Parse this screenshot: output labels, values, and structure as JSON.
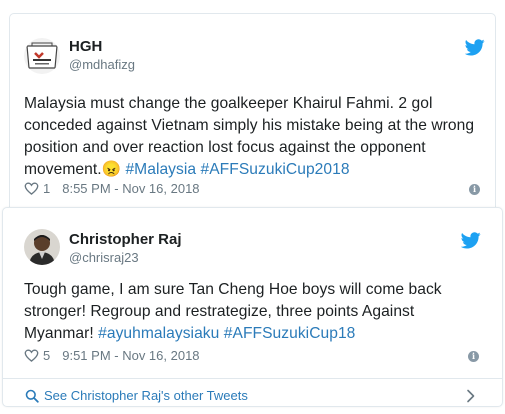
{
  "tweets": [
    {
      "name": "HGH",
      "handle": "@mdhafizg",
      "text_main": "Malaysia must change the goalkeeper Khairul Fahmi. 2 gol conceded against Vietnam simply his mistake being at the wrong position and over reaction lost focus against the opponent movement.",
      "emoji": "😠",
      "hashtags": [
        "#Malaysia",
        "#AFFSuzukiCup2018"
      ],
      "likes": "1",
      "time": "8:55 PM - Nov 16, 2018"
    },
    {
      "name": "Christopher Raj",
      "handle": "@chrisraj23",
      "text_main": "Tough game, I am sure Tan Cheng Hoe boys will come back stronger! Regroup and restrategize, three points Against Myanmar!",
      "hashtags": [
        "#ayuhmalaysiaku",
        "#AFFSuzukiCup18"
      ],
      "likes": "5",
      "time": "9:51 PM - Nov 16, 2018"
    }
  ],
  "footer": {
    "other_tweets_label": "See Christopher Raj's other Tweets"
  },
  "colors": {
    "link_blue": "#2b7bb9",
    "twitter_blue": "#1da1f2",
    "meta_gray": "#697882"
  },
  "icons": {
    "bird": "twitter-bird-icon",
    "heart": "heart-outline-icon",
    "info": "info-icon",
    "search": "search-icon",
    "chevron": "chevron-right-icon"
  }
}
